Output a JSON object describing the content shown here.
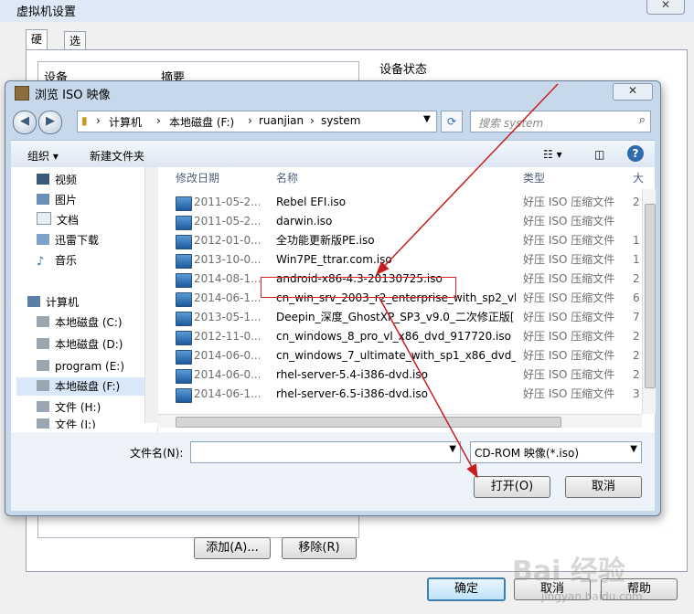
{
  "background_window": {
    "title": "虚拟机设置",
    "tabs": [
      "硬件",
      "选项"
    ],
    "device_header": "设备",
    "summary_header": "摘要",
    "device_status_label": "设备状态",
    "buttons": {
      "add": "添加(A)...",
      "remove": "移除(R)",
      "ok": "确定",
      "cancel": "取消",
      "help": "帮助"
    }
  },
  "dialog": {
    "title": "浏览 ISO 映像",
    "close_glyph": "✕",
    "address": [
      "计算机",
      "本地磁盘 (F:)",
      "ruanjian",
      "system"
    ],
    "search_placeholder": "搜索 system",
    "toolbar": {
      "organize": "组织 ▾",
      "new_folder": "新建文件夹"
    },
    "nav": [
      {
        "label": "视频"
      },
      {
        "label": "图片"
      },
      {
        "label": "文档"
      },
      {
        "label": "迅雷下载"
      },
      {
        "label": "音乐"
      },
      {
        "label": "计算机"
      },
      {
        "label": "本地磁盘 (C:)"
      },
      {
        "label": "本地磁盘 (D:)"
      },
      {
        "label": "program (E:)"
      },
      {
        "label": "本地磁盘 (F:)"
      },
      {
        "label": "文件 (H:)"
      },
      {
        "label": "文件 (J:)"
      }
    ],
    "columns": {
      "date": "修改日期",
      "name": "名称",
      "type": "类型",
      "size": "大"
    },
    "files": [
      {
        "date": "2011-05-2...",
        "name": "Rebel EFI.iso",
        "type": "好压 ISO 压缩文件",
        "size": "2"
      },
      {
        "date": "2011-05-2...",
        "name": "darwin.iso",
        "type": "好压 ISO 压缩文件",
        "size": ""
      },
      {
        "date": "2012-01-0...",
        "name": "全功能更新版PE.iso",
        "type": "好压 ISO 压缩文件",
        "size": "1"
      },
      {
        "date": "2013-10-0...",
        "name": "Win7PE_ttrar.com.iso",
        "type": "好压 ISO 压缩文件",
        "size": "1"
      },
      {
        "date": "2014-08-1...",
        "name": "android-x86-4.3-20130725.iso",
        "type": "好压 ISO 压缩文件",
        "size": "2"
      },
      {
        "date": "2014-06-1...",
        "name": "cn_win_srv_2003_r2_enterprise_with_sp2_vl_...",
        "type": "好压 ISO 压缩文件",
        "size": "6"
      },
      {
        "date": "2013-05-1...",
        "name": "Deepin_深度_GhostXP_SP3_v9.0_二次修正版[...",
        "type": "好压 ISO 压缩文件",
        "size": "7"
      },
      {
        "date": "2012-11-0...",
        "name": "cn_windows_8_pro_vl_x86_dvd_917720.iso",
        "type": "好压 ISO 压缩文件",
        "size": "2"
      },
      {
        "date": "2014-06-0...",
        "name": "cn_windows_7_ultimate_with_sp1_x86_dvd_u...",
        "type": "好压 ISO 压缩文件",
        "size": "2"
      },
      {
        "date": "2014-06-0...",
        "name": "rhel-server-5.4-i386-dvd.iso",
        "type": "好压 ISO 压缩文件",
        "size": "2"
      },
      {
        "date": "2014-06-1...",
        "name": "rhel-server-6.5-i386-dvd.iso",
        "type": "好压 ISO 压缩文件",
        "size": "3"
      }
    ],
    "filename_label": "文件名(N):",
    "filename_value": "",
    "filetype_value": "CD-ROM 映像(*.iso)",
    "open_button": "打开(O)",
    "cancel_button": "取消"
  },
  "watermark": {
    "main": "Bai 经验",
    "sub": "jingyan.baidu.com"
  },
  "colors": {
    "highlight_box": "#e02020",
    "arrow": "#c81e1e",
    "dialog_frame": "#c7d8ea"
  },
  "icons": [
    "back-icon",
    "forward-icon",
    "folder-icon",
    "refresh-icon",
    "search-icon",
    "views-icon",
    "preview-pane-icon",
    "help-icon",
    "iso-file-icon"
  ]
}
